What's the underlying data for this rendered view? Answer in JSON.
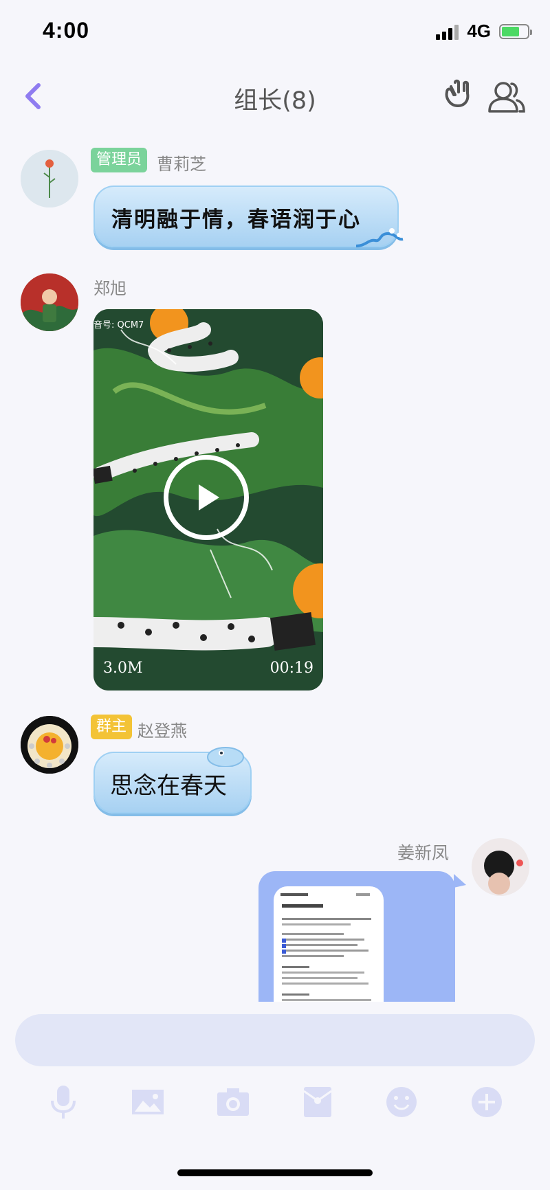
{
  "status": {
    "time": "4:00",
    "network": "4G"
  },
  "nav": {
    "title": "组长(8)"
  },
  "messages": {
    "m1": {
      "role": "管理员",
      "sender": "曹莉芝",
      "text": "清明融于情，春语润于心"
    },
    "m2": {
      "sender": "郑旭",
      "video_top_text": "音号: QCM7",
      "size": "3.0M",
      "duration": "00:19"
    },
    "m3": {
      "role": "群主",
      "sender": "赵登燕",
      "text": "思念在春天"
    },
    "m4": {
      "sender": "姜新凤"
    }
  },
  "colors": {
    "accent": "#8f7cf0",
    "admin_badge": "#7bd39b",
    "owner_badge": "#f3c336",
    "self_bubble": "#9cb6f6"
  },
  "toolbar": {
    "icons": [
      "mic-icon",
      "image-icon",
      "camera-icon",
      "red-packet-icon",
      "emoji-icon",
      "plus-icon"
    ]
  }
}
